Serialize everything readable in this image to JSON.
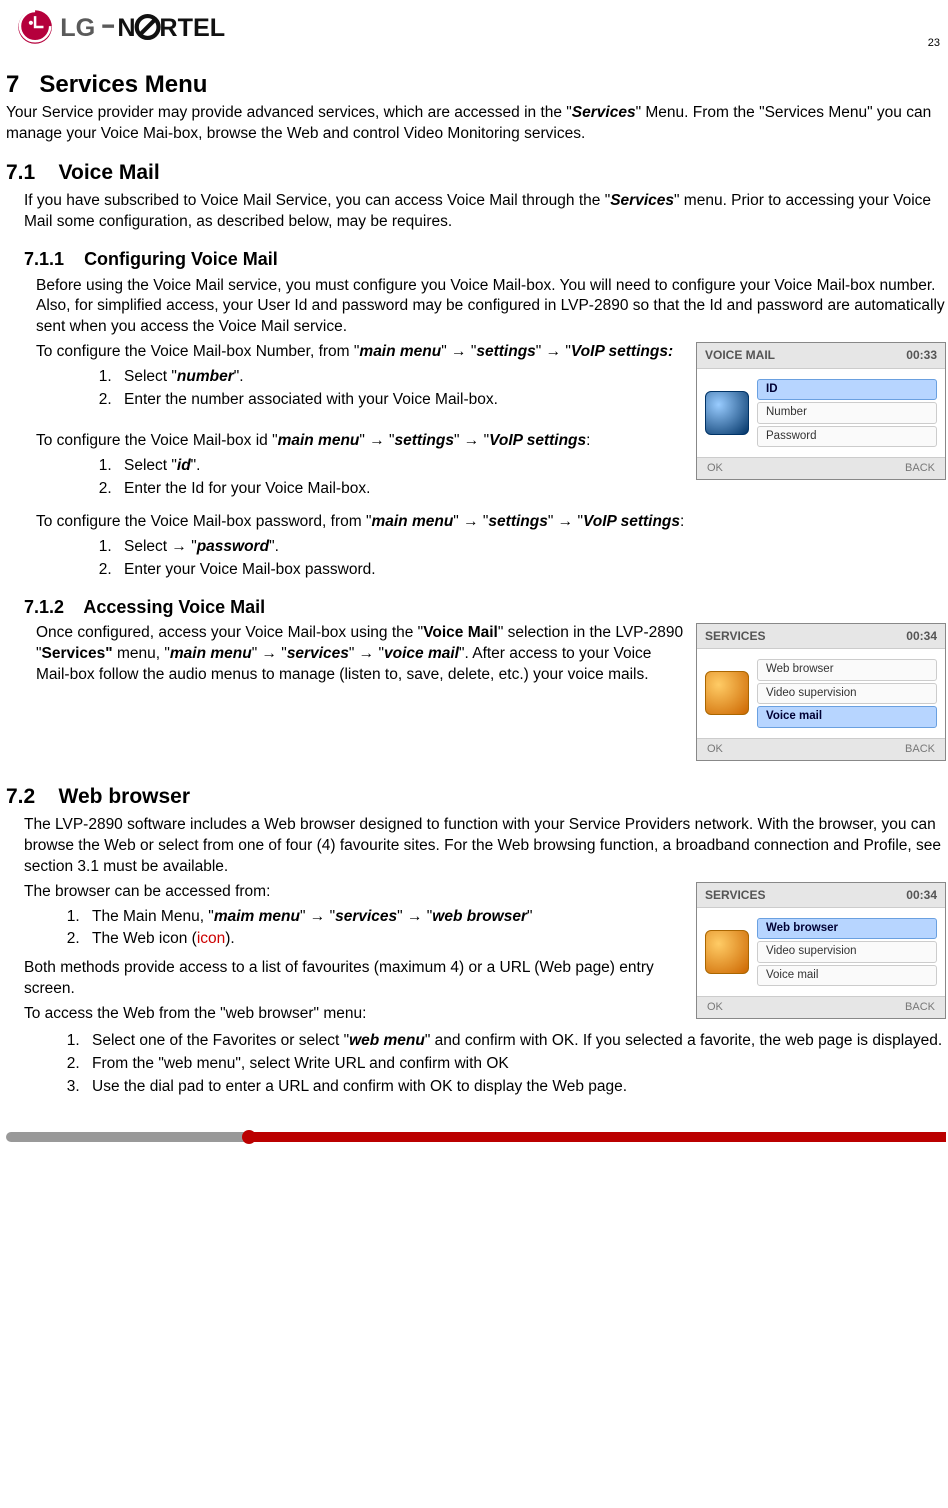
{
  "header": {
    "brand": "LG-NORTEL",
    "page": "23"
  },
  "h1": {
    "num": "7",
    "title": "Services Menu"
  },
  "intro": {
    "p1a": "Your Service provider may provide advanced services, which are accessed in the \"",
    "p1b": "Services",
    "p1c": "\" Menu.  From the \"Services Menu\" you can manage your Voice Mai-box, browse the Web and control Video Monitoring services."
  },
  "s71": {
    "num": "7.1",
    "title": "Voice Mail",
    "p1a": "If you have subscribed to Voice Mail Service, you can access Voice Mail through the \"",
    "p1b": "Services",
    "p1c": "\" menu.  Prior to accessing your Voice Mail some configuration, as described below, may be requires."
  },
  "s711": {
    "num": "7.1.1",
    "title": "Configuring Voice Mail",
    "p1": "Before using the Voice Mail service, you must configure you Voice Mail-box.  You will need to configure your Voice Mail-box number.  Also, for simplified access, your User Id and password may be configured in LVP-2890 so that the Id and password are automatically sent when you access the Voice Mail service.",
    "cfg_num": {
      "a": "To configure the Voice Mail-box Number, from \"",
      "b": "main menu",
      "c": "\" → \"",
      "d": "settings",
      "e": "\" → \"",
      "f": "VoIP settings:",
      "li1a": "Select \"",
      "li1b": "number",
      "li1c": "\".",
      "li2": "Enter the number associated with your Voice Mail-box."
    },
    "cfg_id": {
      "a": "To configure the Voice Mail-box id \"",
      "b": "main menu",
      "c": "\" → \"",
      "d": "settings",
      "e": "\" → \"",
      "f": "VoIP settings",
      "g": ":",
      "li1a": "Select \"",
      "li1b": "id",
      "li1c": "\".",
      "li2": "Enter the Id for your Voice Mail-box."
    },
    "cfg_pw": {
      "a": "To configure the Voice Mail-box password, from \"",
      "b": "main menu",
      "c": "\" → \"",
      "d": "settings",
      "e": "\" → \"",
      "f": "VoIP settings",
      "g": ":",
      "li1a": "Select → \"",
      "li1b": "password",
      "li1c": "\".",
      "li2": "Enter your Voice Mail-box password."
    }
  },
  "s712": {
    "num": "7.1.2",
    "title": "Accessing Voice Mail",
    "a": "Once configured, access your Voice Mail-box using the \"",
    "b": "Voice Mail",
    "c": "\" selection in the LVP-2890 \"",
    "d": "Services\"",
    "e": " menu, \"",
    "f": "main menu",
    "g": "\" → \"",
    "h": "services",
    "i": "\" → \"",
    "j": "voice mail",
    "k": "\".  After access to your Voice Mail-box follow the audio menus to manage (listen to, save, delete, etc.) your voice mails."
  },
  "s72": {
    "num": "7.2",
    "title": "Web browser",
    "p1": "The LVP-2890 software includes a Web browser designed to function with your Service Providers network.  With the browser, you can browse the Web or select from one of four (4) favourite sites.  For the Web browsing function, a broadband connection and Profile, see section 3.1 must be available.",
    "p2": "The browser can be accessed from:",
    "li1a": "The Main Menu, \"",
    "li1b": "maim menu",
    "li1c": "\" → \"",
    "li1d": "services",
    "li1e": "\" → \"",
    "li1f": "web browser",
    "li1g": "\"",
    "li2a": "The Web icon (",
    "li2b": "icon",
    "li2c": ").",
    "p3": "Both methods provide access to a list of favourites (maximum 4) or a URL (Web page) entry screen.",
    "p4": "To access the Web from the \"web browser\" menu:",
    "ol2_1a": "Select one of the Favorites or select \"",
    "ol2_1b": "web menu",
    "ol2_1c": "\" and confirm with OK.  If you selected a favorite, the web page is displayed.",
    "ol2_2": "From the \"web menu\", select Write URL and confirm with OK",
    "ol2_3": "Use the dial pad to enter a URL and confirm with OK to display the Web page."
  },
  "fig_vm": {
    "title": "VOICE MAIL",
    "time": "00:33",
    "items": [
      "ID",
      "Number",
      "Password"
    ],
    "sel": 0,
    "ok": "OK",
    "back": "BACK"
  },
  "fig_sv1": {
    "title": "SERVICES",
    "time": "00:34",
    "items": [
      "Web browser",
      "Video supervision",
      "Voice mail"
    ],
    "sel": 2,
    "ok": "OK",
    "back": "BACK"
  },
  "fig_sv2": {
    "title": "SERVICES",
    "time": "00:34",
    "items": [
      "Web browser",
      "Video supervision",
      "Voice mail"
    ],
    "sel": 0,
    "ok": "OK",
    "back": "BACK"
  }
}
